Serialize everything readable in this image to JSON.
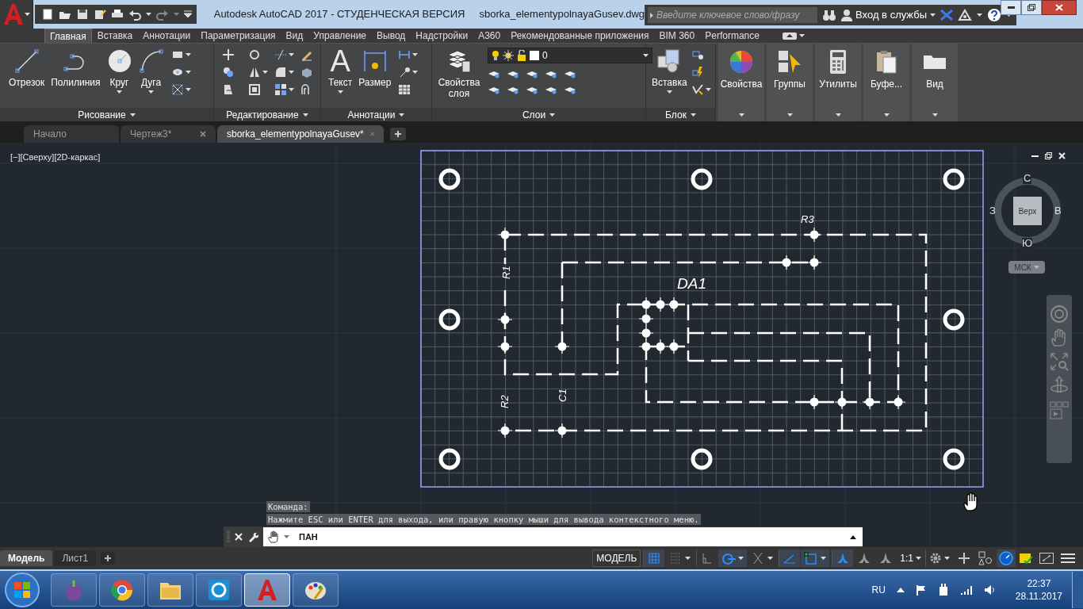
{
  "title_bar": {
    "title": "Autodesk AutoCAD 2017 - СТУДЕНЧЕСКАЯ ВЕРСИЯ",
    "file": "sborka_elementypolnayaGusev.dwg",
    "search_placeholder": "Введите ключевое слово/фразу",
    "sign_in": "Вход в службы"
  },
  "ribbon_tabs": [
    {
      "label": "Главная",
      "selected": true
    },
    {
      "label": "Вставка",
      "selected": false
    },
    {
      "label": "Аннотации",
      "selected": false
    },
    {
      "label": "Параметризация",
      "selected": false
    },
    {
      "label": "Вид",
      "selected": false
    },
    {
      "label": "Управление",
      "selected": false
    },
    {
      "label": "Вывод",
      "selected": false
    },
    {
      "label": "Надстройки",
      "selected": false
    },
    {
      "label": "A360",
      "selected": false
    },
    {
      "label": "Рекомендованные приложения",
      "selected": false
    },
    {
      "label": "BIM 360",
      "selected": false
    },
    {
      "label": "Performance",
      "selected": false
    }
  ],
  "ribbon_panels": [
    {
      "kind": "draw",
      "title": "Рисование",
      "tools": [
        {
          "label": "Отрезок",
          "kind": "line",
          "menu": false
        },
        {
          "label": "Полилиния",
          "kind": "polyline",
          "menu": false
        },
        {
          "label": "Круг",
          "kind": "circle",
          "menu": true
        },
        {
          "label": "Дуга",
          "kind": "arc",
          "menu": true
        }
      ]
    },
    {
      "kind": "modify",
      "title": "Редактирование"
    },
    {
      "kind": "annotate",
      "title": "Аннотации",
      "tools": [
        {
          "label": "Текст",
          "kind": "text",
          "glyph": "A",
          "menu": true
        },
        {
          "label": "Размер",
          "kind": "dimension",
          "menu": false
        }
      ]
    },
    {
      "kind": "layers",
      "title": "Слои",
      "layer": "0",
      "tools": [
        {
          "label": "Свойства слоя",
          "kind": "layers",
          "menu": false
        }
      ]
    },
    {
      "kind": "block",
      "title": "Блок",
      "tools": [
        {
          "label": "Вставка",
          "kind": "insert",
          "menu": true
        }
      ]
    },
    {
      "kind": "single",
      "tools": [
        {
          "label": "Свойства",
          "kind": "color-wheel",
          "menu": false
        }
      ]
    },
    {
      "kind": "single",
      "tools": [
        {
          "label": "Группы",
          "kind": "group",
          "menu": false
        }
      ]
    },
    {
      "kind": "single",
      "tools": [
        {
          "label": "Утилиты",
          "kind": "calculator",
          "menu": false
        }
      ]
    },
    {
      "kind": "single",
      "tools": [
        {
          "label": "Буфе...",
          "kind": "clipboard",
          "menu": false
        }
      ]
    },
    {
      "kind": "single",
      "tools": [
        {
          "label": "Вид",
          "kind": "folder",
          "menu": false
        }
      ]
    }
  ],
  "file_tabs": [
    {
      "label": "Начало",
      "selected": false,
      "closable": false
    },
    {
      "label": "Чертеж3*",
      "selected": false,
      "closable": true
    },
    {
      "label": "sborka_elementypolnayaGusev*",
      "selected": true,
      "closable": true
    }
  ],
  "viewport": {
    "label": "[−][Сверху][2D-каркас]",
    "viewcube": {
      "north": "С",
      "east": "В",
      "south": "Ю",
      "west": "З",
      "face": "Верх"
    },
    "ucs": "МСК"
  },
  "drawing": {
    "labels": [
      {
        "text": "R3"
      },
      {
        "text": "R1"
      },
      {
        "text": "DA1"
      },
      {
        "text": "R2"
      },
      {
        "text": "C1"
      }
    ]
  },
  "command_line": {
    "history": [
      "Команда:",
      "Нажмите ESC или ENTER для выхода, или правую кнопку мыши для вывода контекстного меню."
    ],
    "input": "ПАН"
  },
  "layout_tabs": [
    {
      "label": "Модель",
      "selected": true
    },
    {
      "label": "Лист1",
      "selected": false
    }
  ],
  "status_bar": {
    "model": "МОДЕЛЬ",
    "scale": "1:1",
    "toggles": [
      {
        "kind": "grid",
        "on": true
      },
      {
        "kind": "snap",
        "on": false
      },
      {
        "kind": "ortho",
        "on": false
      },
      {
        "kind": "polar",
        "on": true
      },
      {
        "kind": "isodraft",
        "on": false
      },
      {
        "kind": "otrack",
        "on": true
      },
      {
        "kind": "osnap",
        "on": true
      },
      {
        "kind": "annotation",
        "on": true
      },
      {
        "kind": "autoscale",
        "on": false
      },
      {
        "kind": "annoscale",
        "on": false
      }
    ]
  },
  "taskbar": {
    "apps": [
      {
        "kind": "onion",
        "active": false
      },
      {
        "kind": "browser",
        "active": false
      },
      {
        "kind": "folder",
        "active": false
      },
      {
        "kind": "viewer",
        "active": false
      },
      {
        "kind": "cad",
        "active": true
      },
      {
        "kind": "paint",
        "active": false
      }
    ],
    "language": "RU",
    "time": "22:37",
    "date": "28.11.2017"
  }
}
